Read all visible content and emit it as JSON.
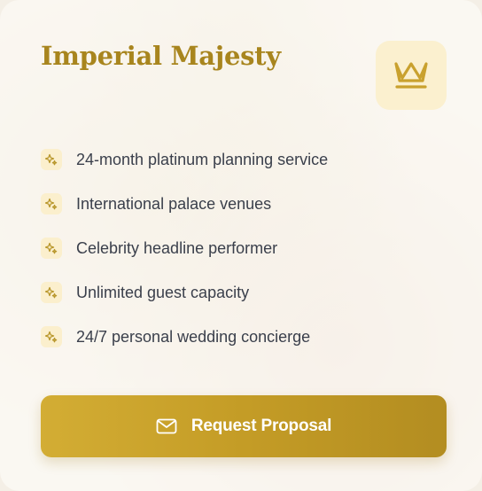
{
  "card": {
    "title": "Imperial Majesty",
    "badge_icon": "crown-icon",
    "accent_color": "#a8851e",
    "features": [
      {
        "icon": "sparkle-icon",
        "label": "24-month platinum planning service"
      },
      {
        "icon": "sparkle-icon",
        "label": "International palace venues"
      },
      {
        "icon": "sparkle-icon",
        "label": "Celebrity headline performer"
      },
      {
        "icon": "sparkle-icon",
        "label": "Unlimited guest capacity"
      },
      {
        "icon": "sparkle-icon",
        "label": "24/7 personal wedding concierge"
      }
    ],
    "cta": {
      "icon": "mail-icon",
      "label": "Request Proposal",
      "color": "#c49c26"
    }
  }
}
